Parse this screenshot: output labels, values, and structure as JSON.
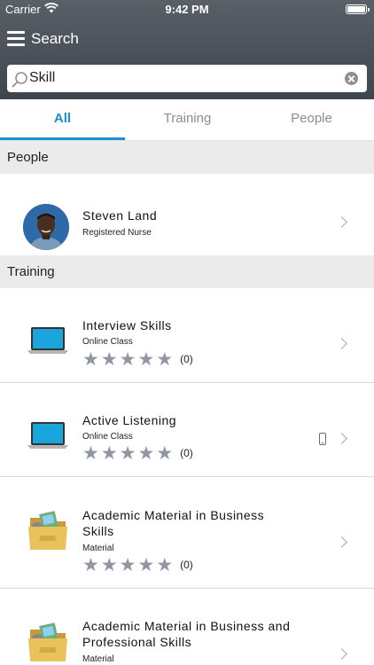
{
  "status_bar": {
    "carrier": "Carrier",
    "time": "9:42 PM"
  },
  "header": {
    "title": "Search"
  },
  "search": {
    "value": "Skill"
  },
  "tabs": [
    {
      "label": "All",
      "active": true
    },
    {
      "label": "Training",
      "active": false
    },
    {
      "label": "People",
      "active": false
    }
  ],
  "sections": {
    "people": "People",
    "training": "Training"
  },
  "people": [
    {
      "name": "Steven Land",
      "role": "Registered Nurse"
    }
  ],
  "training": [
    {
      "title": "Interview Skills",
      "type": "Online Class",
      "rating": 0,
      "count": "(0)",
      "icon": "laptop-icon"
    },
    {
      "title": "Active Listening",
      "type": "Online Class",
      "rating": 0,
      "count": "(0)",
      "icon": "laptop-icon",
      "mobile": true
    },
    {
      "title": "Academic Material in Business Skills",
      "type": "Material",
      "rating": 0,
      "count": "(0)",
      "icon": "folder-icon"
    },
    {
      "title": "Academic Material in Business and Professional Skills",
      "type": "Material",
      "icon": "folder-icon"
    }
  ],
  "colors": {
    "accent": "#1a8ed6",
    "header": "#4a5057",
    "star": "#8f97a3"
  }
}
